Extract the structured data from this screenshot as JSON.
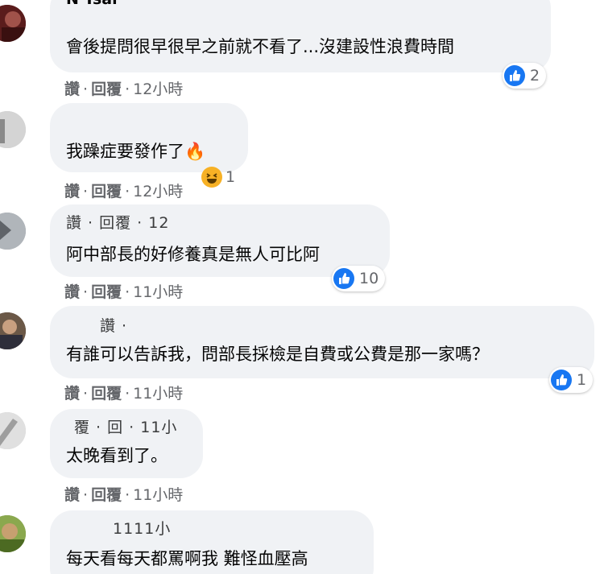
{
  "comments": [
    {
      "name": "N Tsai",
      "text": "會後提問很早很早之前就不看了...沒建設性浪費時間",
      "like_label": "讚",
      "reply_label": "回覆",
      "time": "12小時",
      "reaction_count": "2"
    },
    {
      "name": "",
      "text": "我躁症要發作了",
      "emoji": "🔥",
      "like_label": "讚",
      "reply_label": "回覆",
      "time": "12小時",
      "reaction_count": "1"
    },
    {
      "name_overlay": "讚 · 回覆 · 12",
      "text": "阿中部長的好修養真是無人可比阿",
      "like_label": "讚",
      "reply_label": "回覆",
      "time": "11小時",
      "reaction_count": "10"
    },
    {
      "name": "讚 ·",
      "text": "有誰可以告訴我，問部長採檢是自費或公費是那一家嗎？",
      "like_label": "讚",
      "reply_label": "回覆",
      "time": "11小時",
      "reaction_count": "1"
    },
    {
      "name": "覆 · 回 · 11小",
      "text": "太晚看到了。",
      "like_label": "讚",
      "reply_label": "回覆",
      "time": "11小時"
    },
    {
      "name": "1111小",
      "text": "每天看每天都罵啊我 難怪血壓高"
    }
  ]
}
